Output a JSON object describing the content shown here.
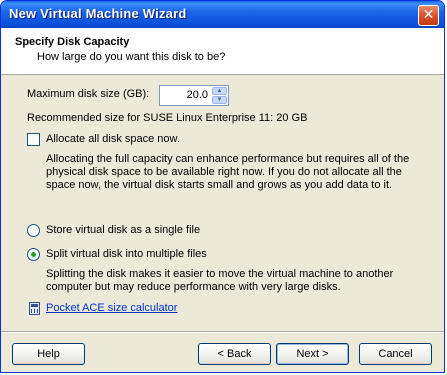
{
  "window": {
    "title": "New Virtual Machine Wizard",
    "close_glyph": "✕"
  },
  "header": {
    "title": "Specify Disk Capacity",
    "subtitle": "How large do you want this disk to be?"
  },
  "disk_size": {
    "label": "Maximum disk size (GB):",
    "value": "20.0",
    "recommended": "Recommended size for SUSE Linux Enterprise 11: 20 GB"
  },
  "allocate": {
    "label": "Allocate all disk space now.",
    "checked": false,
    "description_lines": [
      "Allocating the full capacity can enhance performance but requires all of the",
      "physical disk space to be available right now. If you do not allocate all the",
      "space now, the virtual disk starts small and grows as you add data to it."
    ]
  },
  "storage_options": {
    "single_file_label": "Store virtual disk as a single file",
    "multiple_files_label": "Split virtual disk into multiple files",
    "selected": "multiple_files",
    "split_description_lines": [
      "Splitting the disk makes it easier to move the virtual machine to another",
      "computer but may reduce performance with very large disks."
    ]
  },
  "link": {
    "label": "Pocket ACE size calculator",
    "icon": "calculator-icon"
  },
  "buttons": {
    "help": "Help",
    "back": "< Back",
    "next": "Next >",
    "cancel": "Cancel"
  }
}
